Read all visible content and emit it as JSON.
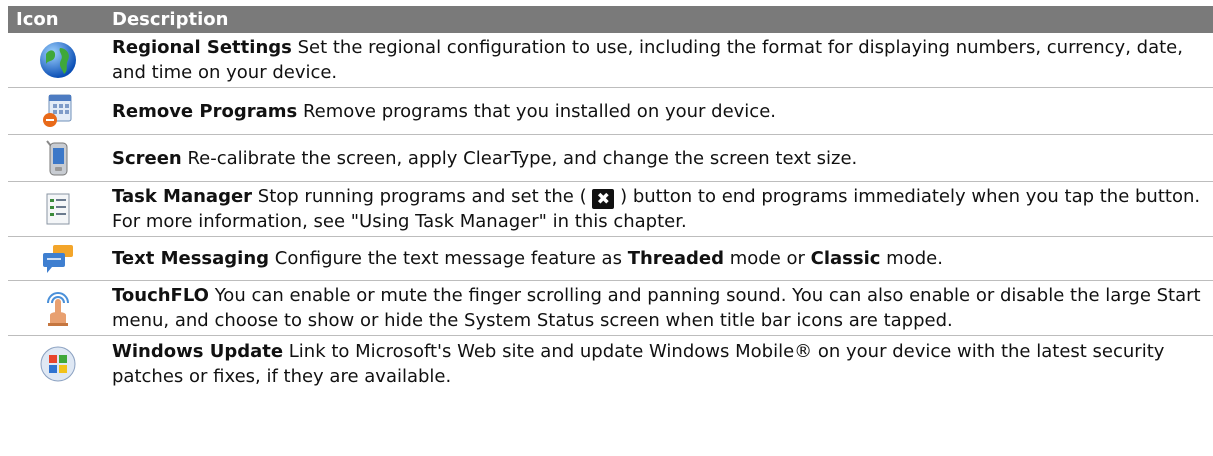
{
  "header": {
    "col_icon": "Icon",
    "col_description": "Description"
  },
  "rows": [
    {
      "icon": "globe-icon",
      "title": "Regional Settings",
      "text": "  Set the regional configuration to use, including the format for displaying numbers, currency, date, and time on your device."
    },
    {
      "icon": "remove-programs-icon",
      "title": "Remove Programs",
      "text": "  Remove programs that you installed on your device."
    },
    {
      "icon": "screen-icon",
      "title": "Screen",
      "text": "  Re-calibrate the screen, apply ClearType, and change the screen text size."
    },
    {
      "icon": "task-manager-icon",
      "title": "Task Manager",
      "text_a": "  Stop running programs and set the ( ",
      "x_glyph": "✖",
      "text_b": " ) button to end programs immediately when you tap the button. For more information, see \"Using Task Manager\" in this chapter."
    },
    {
      "icon": "text-messaging-icon",
      "title": "Text Messaging",
      "text_a": "  Configure the text message feature as ",
      "bold_a": "Threaded",
      "text_b": " mode or ",
      "bold_b": "Classic",
      "text_c": " mode."
    },
    {
      "icon": "touchflo-icon",
      "title": "TouchFLO",
      "text": "  You can enable or mute the finger scrolling and panning sound. You can also enable or disable the large Start menu, and choose to show or hide the System Status screen when title bar icons are tapped."
    },
    {
      "icon": "windows-update-icon",
      "title": "Windows Update",
      "text": "  Link to Microsoft's Web site and update Windows Mobile® on your device with the latest security patches or fixes, if they are available."
    }
  ]
}
